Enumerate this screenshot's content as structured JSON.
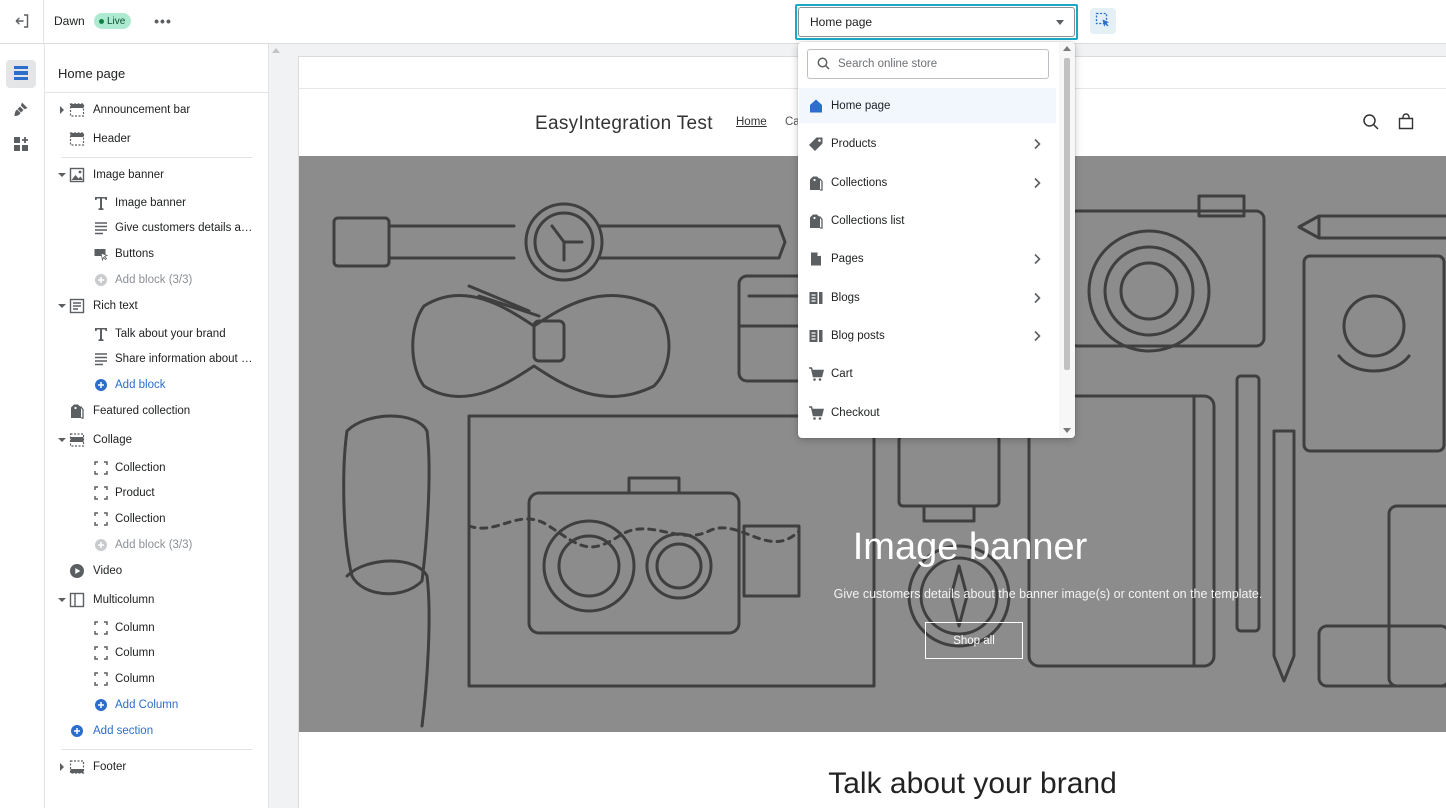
{
  "topbar": {
    "theme_name": "Dawn",
    "live_badge": "Live",
    "page_select_value": "Home page"
  },
  "sidebar": {
    "title": "Home page",
    "tree": [
      {
        "label": "Announcement bar"
      },
      {
        "label": "Header"
      },
      {
        "label": "Image banner"
      },
      {
        "label": "Image banner"
      },
      {
        "label": "Give customers details about the banner image(s) or content on the template."
      },
      {
        "label": "Buttons"
      },
      {
        "label": "Add block (3/3)"
      },
      {
        "label": "Rich text"
      },
      {
        "label": "Talk about your brand"
      },
      {
        "label": "Share information about your brand with your customers."
      },
      {
        "label": "Add block"
      },
      {
        "label": "Featured collection"
      },
      {
        "label": "Collage"
      },
      {
        "label": "Collection"
      },
      {
        "label": "Product"
      },
      {
        "label": "Collection"
      },
      {
        "label": "Add block (3/3)"
      },
      {
        "label": "Video"
      },
      {
        "label": "Multicolumn"
      },
      {
        "label": "Column"
      },
      {
        "label": "Column"
      },
      {
        "label": "Column"
      },
      {
        "label": "Add Column"
      },
      {
        "label": "Add section"
      },
      {
        "label": "Footer"
      }
    ]
  },
  "preview": {
    "store_name": "EasyIntegration Test",
    "nav": [
      "Home",
      "Ca"
    ],
    "banner_title": "Image banner",
    "banner_text": "Give customers details about the banner image(s) or content on the template.",
    "banner_button": "Shop all",
    "rich_text_title": "Talk about your brand"
  },
  "dropdown": {
    "search_placeholder": "Search online store",
    "items": [
      {
        "label": "Home page",
        "icon": "home-icon",
        "has_submenu": false
      },
      {
        "label": "Products",
        "icon": "tag-icon",
        "has_submenu": true
      },
      {
        "label": "Collections",
        "icon": "collection-icon",
        "has_submenu": true
      },
      {
        "label": "Collections list",
        "icon": "collection-icon",
        "has_submenu": false
      },
      {
        "label": "Pages",
        "icon": "page-icon",
        "has_submenu": true
      },
      {
        "label": "Blogs",
        "icon": "blog-icon",
        "has_submenu": true
      },
      {
        "label": "Blog posts",
        "icon": "blog-icon",
        "has_submenu": true
      },
      {
        "label": "Cart",
        "icon": "cart-icon",
        "has_submenu": false
      },
      {
        "label": "Checkout",
        "icon": "cart-icon",
        "has_submenu": false
      }
    ]
  },
  "colors": {
    "accent": "#2c6ecb",
    "focus_ring": "#1ba8c7",
    "live_badge_bg": "#aee9d1",
    "banner_bg": "#8c8c8c"
  }
}
